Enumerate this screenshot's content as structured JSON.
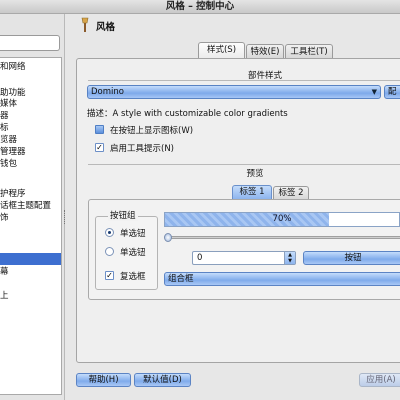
{
  "window": {
    "title": "风格 – 控制中心"
  },
  "sidebar": {
    "items": [
      {
        "label": "和网络"
      },
      {
        "label": "助功能"
      },
      {
        "label": "媒体"
      },
      {
        "label": "器"
      },
      {
        "label": "标"
      },
      {
        "label": "览器"
      },
      {
        "label": "管理器"
      },
      {
        "label": "钱包"
      },
      {
        "label": "护程序"
      },
      {
        "label": "话框主题配置"
      },
      {
        "label": "饰"
      },
      {
        "label": "幕"
      },
      {
        "label": "上"
      }
    ],
    "selected_index": 11
  },
  "page": {
    "title": "风格"
  },
  "tabs": [
    {
      "label": "样式(S)"
    },
    {
      "label": "特效(E)"
    },
    {
      "label": "工具栏(T)"
    }
  ],
  "widget_style": {
    "section_label": "部件样式",
    "selected": "Domino",
    "config_button": "配",
    "description": "描述：A style with customizable color gradients",
    "options": [
      {
        "label": "在按钮上显示图标(W)",
        "checked": false
      },
      {
        "label": "启用工具提示(N)",
        "checked": true
      }
    ]
  },
  "preview": {
    "section_label": "预览",
    "tabs": [
      {
        "label": "标签 1"
      },
      {
        "label": "标签 2"
      }
    ],
    "group_title": "按钮组",
    "radios": [
      {
        "label": "单选钮",
        "checked": true
      },
      {
        "label": "单选钮",
        "checked": false
      }
    ],
    "checkbox": {
      "label": "复选框",
      "checked": true
    },
    "progress": {
      "value": 70,
      "label": "70%"
    },
    "slider_value": 0,
    "spin_value": "0",
    "push_button": "按钮",
    "combo": "组合框"
  },
  "buttons": {
    "help": "帮助(H)",
    "defaults": "默认值(D)",
    "apply": "应用(A)"
  },
  "colors": {
    "accent": "#3d6fd0",
    "button_gradient_top": "#c4dcfb",
    "button_gradient_mid": "#80abeb"
  },
  "icons": {
    "page_icon": "brush-icon",
    "combo_arrow": "chevron-down-icon"
  }
}
